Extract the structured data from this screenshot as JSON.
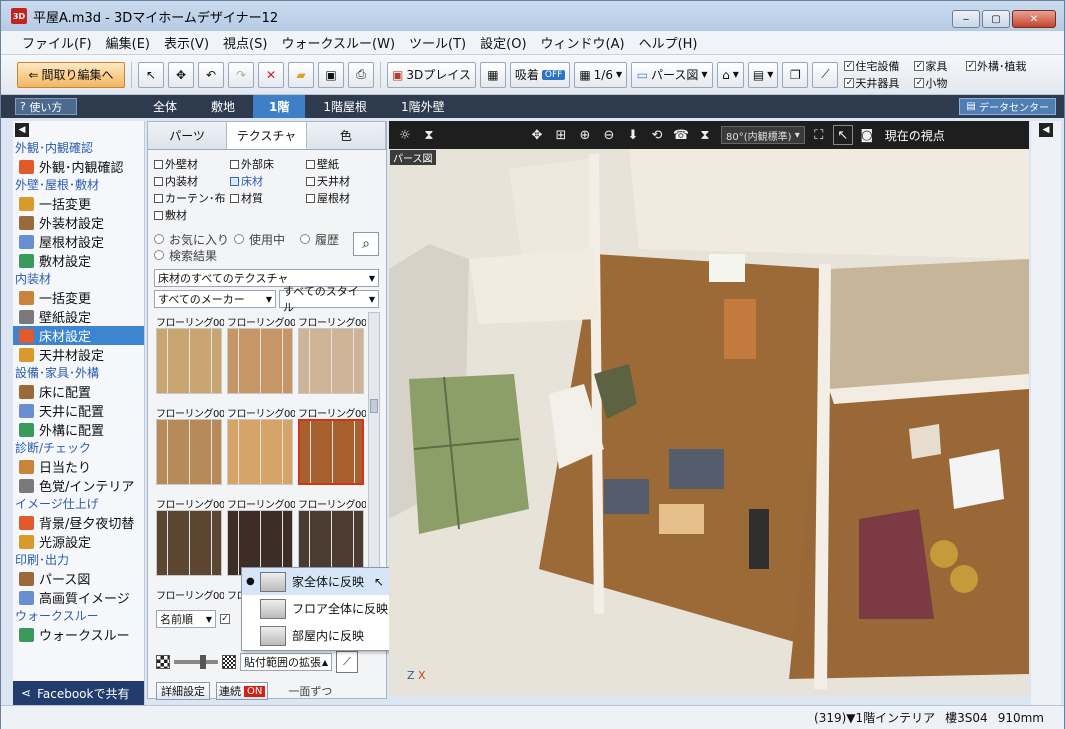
{
  "window": {
    "title": "平屋A.m3d - 3Dマイホームデザイナー12",
    "app_icon_text": "3D",
    "minimize": "‒",
    "maximize": "▢",
    "close": "✕"
  },
  "menu": [
    "ファイル(F)",
    "編集(E)",
    "表示(V)",
    "視点(S)",
    "ウォークスルー(W)",
    "ツール(T)",
    "設定(O)",
    "ウィンドウ(A)",
    "ヘルプ(H)"
  ],
  "toolbar": {
    "layout_edit": "間取り編集へ",
    "place_3d": "3Dプレイス",
    "snap": "吸着",
    "snap_state": "OFF",
    "grid": "1/6",
    "view_mode": "パース図",
    "checks": [
      "住宅設備",
      "天井器具",
      "家具",
      "小物",
      "外構･植栽"
    ]
  },
  "tabbar": {
    "help": "使い方",
    "tabs": [
      "全体",
      "敷地",
      "1階",
      "1階屋根",
      "1階外壁"
    ],
    "active_tab": "1階",
    "datacenter": "データセンター"
  },
  "sidebar": {
    "sections": [
      {
        "title": "外観･内観確認",
        "items": [
          "外観･内観確認"
        ]
      },
      {
        "title": "外壁･屋根･敷材",
        "items": [
          "一括変更",
          "外装材設定",
          "屋根材設定",
          "敷材設定"
        ]
      },
      {
        "title": "内装材",
        "items": [
          "一括変更",
          "壁紙設定",
          "床材設定",
          "天井材設定"
        ]
      },
      {
        "title": "設備･家具･外構",
        "items": [
          "床に配置",
          "天井に配置",
          "外構に配置"
        ]
      },
      {
        "title": "診断/チェック",
        "items": [
          "日当たり",
          "色覚/インテリア"
        ]
      },
      {
        "title": "イメージ仕上げ",
        "items": [
          "背景/昼夕夜切替",
          "光源設定"
        ]
      },
      {
        "title": "印刷･出力",
        "items": [
          "パース図",
          "高画質イメージ"
        ]
      },
      {
        "title": "ウォークスルー",
        "items": [
          "ウォークスルー"
        ]
      }
    ],
    "active_item": "床材設定",
    "facebook": "Facebookで共有"
  },
  "panel": {
    "tabs": [
      "パーツ",
      "テクスチャ",
      "色"
    ],
    "active_tab": "テクスチャ",
    "categories": [
      "外壁材",
      "外部床",
      "壁紙",
      "内装材",
      "床材",
      "天井材",
      "カーテン･布",
      "材質",
      "屋根材",
      "敷材"
    ],
    "selected_category": "床材",
    "filters": [
      "お気に入り",
      "使用中",
      "履歴",
      "検索結果"
    ],
    "texture_dropdown": "床材のすべてのテクスチャ",
    "maker_dropdown": "すべてのメーカー",
    "style_dropdown": "すべてのスタイル",
    "textures": [
      {
        "label": "フローリング00...",
        "color": "#c9a670"
      },
      {
        "label": "フローリング00...",
        "color": "#c69766"
      },
      {
        "label": "フローリング00...",
        "color": "#cfb497"
      },
      {
        "label": "フローリング00...",
        "color": "#b78b57"
      },
      {
        "label": "フローリング00...",
        "color": "#d6a368"
      },
      {
        "label": "フローリング00...",
        "color": "#a8602e"
      },
      {
        "label": "フローリング00...",
        "color": "#5c4631"
      },
      {
        "label": "フローリング00...",
        "color": "#3e2d25"
      },
      {
        "label": "フローリング00...",
        "color": "#4b3b31"
      },
      {
        "label": "フローリング00...",
        "color": ""
      },
      {
        "label": "フロ",
        "color": ""
      }
    ],
    "sort": "名前順",
    "range": "貼付範囲の拡張",
    "detail": "詳細設定",
    "continuous": "連続",
    "continuous_state": "ON",
    "one_side": "一面ずつ"
  },
  "popup": {
    "items": [
      "家全体に反映",
      "フロア全体に反映",
      "部屋内に反映"
    ],
    "checked": "家全体に反映"
  },
  "viewport": {
    "fov": "80°(内観標準)",
    "viewpoint": "現在の視点",
    "label": "パース図",
    "axis_z": "Z",
    "axis_x": "X"
  },
  "status": {
    "location": "(319)▼1階インテリア",
    "code": "樓3S04",
    "size": "910mm"
  },
  "colors": {
    "accent": "#3d86cf",
    "floor_wood": "#9b6a36",
    "tatami": "#8da06a"
  }
}
